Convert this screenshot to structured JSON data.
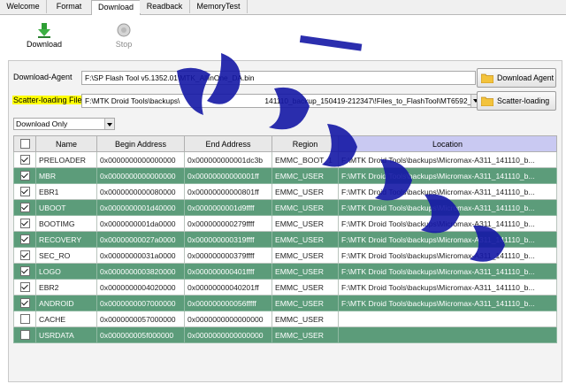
{
  "tabs": [
    {
      "label": "Welcome",
      "active": false
    },
    {
      "label": "Format",
      "active": false
    },
    {
      "label": "Download",
      "active": true
    },
    {
      "label": "Readback",
      "active": false
    },
    {
      "label": "MemoryTest",
      "active": false
    }
  ],
  "toolbar": {
    "download_label": "Download",
    "stop_label": "Stop"
  },
  "download_agent": {
    "label": "Download-Agent",
    "path": "F:\\SP Flash Tool v5.1352.01\\MTK_AllInOne_DA.bin",
    "button_label": "Download Agent"
  },
  "scatter": {
    "label": "Scatter-loading File",
    "path_start": "F:\\MTK Droid Tools\\backups\\",
    "path_end": "141110_backup_150419-212347\\!Files_to_FlashTool\\MT6592_A",
    "button_label": "Scatter-loading"
  },
  "mode": {
    "selected": "Download Only"
  },
  "table": {
    "headers": [
      "Name",
      "Begin Address",
      "End Address",
      "Region",
      "Location"
    ],
    "rows": [
      {
        "checked": true,
        "name": "PRELOADER",
        "begin": "0x0000000000000000",
        "end": "0x000000000001dc3b",
        "region": "EMMC_BOOT_1",
        "location": "F:\\MTK Droid Tools\\backups\\Micromax-A311_141110_b..."
      },
      {
        "checked": true,
        "name": "MBR",
        "begin": "0x0000000000000000",
        "end": "0x00000000000001ff",
        "region": "EMMC_USER",
        "location": "F:\\MTK Droid Tools\\backups\\Micromax-A311_141110_b..."
      },
      {
        "checked": true,
        "name": "EBR1",
        "begin": "0x0000000000080000",
        "end": "0x00000000000801ff",
        "region": "EMMC_USER",
        "location": "F:\\MTK Droid Tools\\backups\\Micromax-A311_141110_b..."
      },
      {
        "checked": true,
        "name": "UBOOT",
        "begin": "0x0000000001d40000",
        "end": "0x0000000001d9ffff",
        "region": "EMMC_USER",
        "location": "F:\\MTK Droid Tools\\backups\\Micromax-A311_141110_b..."
      },
      {
        "checked": true,
        "name": "BOOTIMG",
        "begin": "0x0000000001da0000",
        "end": "0x000000000279ffff",
        "region": "EMMC_USER",
        "location": "F:\\MTK Droid Tools\\backups\\Micromax-A311_141110_b..."
      },
      {
        "checked": true,
        "name": "RECOVERY",
        "begin": "0x00000000027a0000",
        "end": "0x000000000319ffff",
        "region": "EMMC_USER",
        "location": "F:\\MTK Droid Tools\\backups\\Micromax-A311_141110_b..."
      },
      {
        "checked": true,
        "name": "SEC_RO",
        "begin": "0x00000000031a0000",
        "end": "0x000000000379ffff",
        "region": "EMMC_USER",
        "location": "F:\\MTK Droid Tools\\backups\\Micromax-A311_141110_b..."
      },
      {
        "checked": true,
        "name": "LOGO",
        "begin": "0x0000000003820000",
        "end": "0x000000000401ffff",
        "region": "EMMC_USER",
        "location": "F:\\MTK Droid Tools\\backups\\Micromax-A311_141110_b..."
      },
      {
        "checked": true,
        "name": "EBR2",
        "begin": "0x0000000004020000",
        "end": "0x00000000040201ff",
        "region": "EMMC_USER",
        "location": "F:\\MTK Droid Tools\\backups\\Micromax-A311_141110_b..."
      },
      {
        "checked": true,
        "name": "ANDROID",
        "begin": "0x0000000007000000",
        "end": "0x000000000056fffff",
        "region": "EMMC_USER",
        "location": "F:\\MTK Droid Tools\\backups\\Micromax-A311_141110_b..."
      },
      {
        "checked": false,
        "name": "CACHE",
        "begin": "0x0000000057000000",
        "end": "0x0000000000000000",
        "region": "EMMC_USER",
        "location": ""
      },
      {
        "checked": false,
        "name": "USRDATA",
        "begin": "0x000000005f000000",
        "end": "0x0000000000000000",
        "region": "EMMC_USER",
        "location": ""
      }
    ]
  },
  "colors": {
    "green_row": "#5c9c7a",
    "location_header": "#c9c9f2",
    "highlight": "#ffff00",
    "watermark": "#1518a6"
  }
}
